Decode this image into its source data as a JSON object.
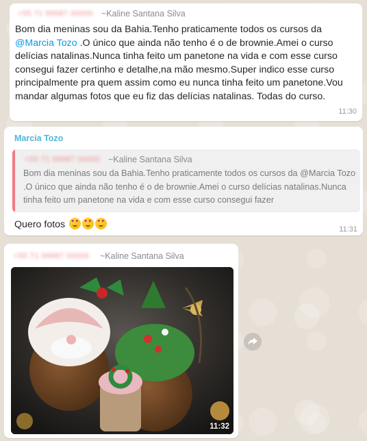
{
  "messages": [
    {
      "phone": "+55 71 99987 00000",
      "sender": "~Kaline Santana Silva",
      "text_before": "Bom dia meninas sou da Bahia.Tenho praticamente todos os cursos da ",
      "mention": "@Marcia Tozo",
      "text_after": " .O único que ainda não tenho é o de brownie.Amei o curso delícias natalinas.Nunca tinha feito um panetone na vida e com esse curso consegui fazer certinho e detalhe,na mão mesmo.Super indico esse curso principalmente pra quem assim como eu nunca tinha feito um panetone.Vou mandar algumas fotos que eu fiz das delícias natalinas. Todas do curso.",
      "time": "11:30"
    },
    {
      "author": "Marcia Tozo",
      "quote": {
        "phone": "+55 71 99987 00000",
        "sender": "~Kaline Santana Silva",
        "text": "Bom dia meninas sou da Bahia.Tenho praticamente todos os cursos da @Marcia Tozo .O único que ainda não tenho é o de brownie.Amei o curso delícias natalinas.Nunca tinha feito um panetone na vida e com esse curso consegui fazer"
      },
      "text": "Quero fotos",
      "emoji": [
        "heart-eyes-emoji",
        "heart-eyes-emoji",
        "heart-eyes-emoji"
      ],
      "time": "11:31"
    },
    {
      "phone": "+55 71 99987 00000",
      "sender": "~Kaline Santana Silva",
      "image_icon": "photo-panetones",
      "time": "11:32"
    }
  ],
  "icons": {
    "forward": "forward-icon"
  },
  "colors": {
    "mention": "#039be5",
    "author": "#4fb6d8",
    "quote_bar": "#f07b82",
    "phone_blur": "#f28b8b"
  }
}
